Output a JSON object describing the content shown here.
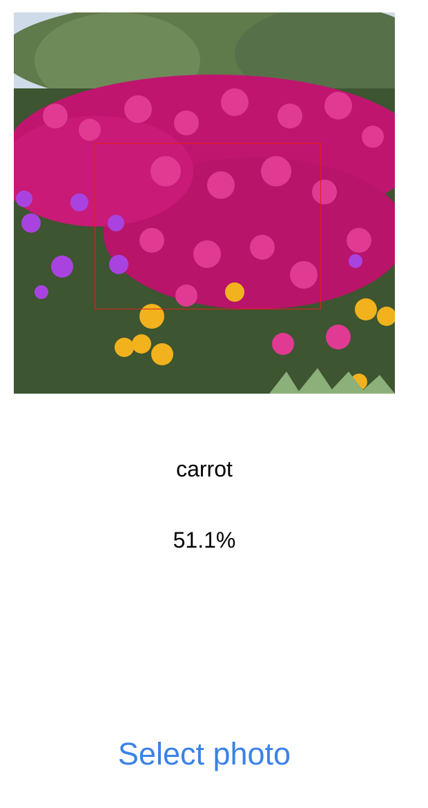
{
  "image": {
    "subject": "field of magenta ice plant flowers with purple and yellow blooms",
    "palette": {
      "sky": "#cfdbe8",
      "foliage": "#4d6a3e",
      "magenta": "#d0177a",
      "purple": "#a943e0",
      "yellow": "#f2b21e",
      "bbox": "#e0201a"
    }
  },
  "result": {
    "class_label": "carrot",
    "confidence": "51.1%"
  },
  "actions": {
    "select_photo_label": "Select photo"
  },
  "accent_color": "#3b82e6"
}
